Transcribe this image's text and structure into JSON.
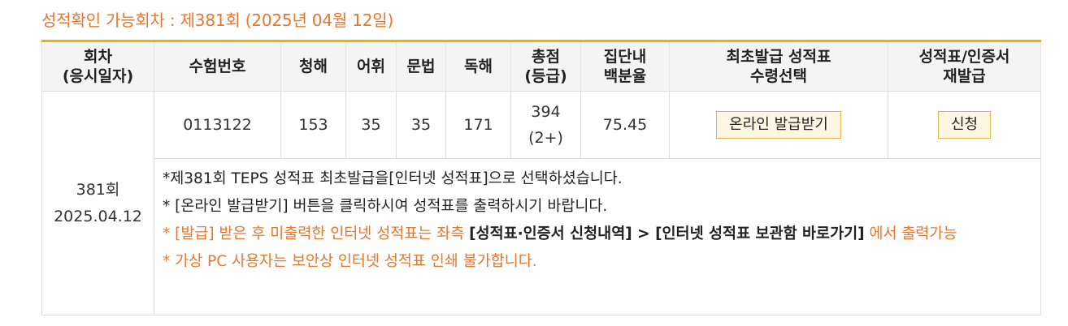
{
  "heading": "성적확인 가능회차 : 제381회 (2025년 04월 12일)",
  "table": {
    "headers": {
      "round_line1": "회차",
      "round_line2": "(응시일자)",
      "exam_no": "수험번호",
      "listening": "청해",
      "vocab": "어휘",
      "grammar": "문법",
      "reading": "독해",
      "total_line1": "총점",
      "total_line2": "(등급)",
      "pct_line1": "집단내",
      "pct_line2": "백분율",
      "issue_line1": "최초발급 성적표",
      "issue_line2": "수령선택",
      "reissue_line1": "성적표/인증서",
      "reissue_line2": "재발급"
    },
    "row": {
      "round": "381회",
      "date": "2025.04.12",
      "exam_no": "0113122",
      "listening": "153",
      "vocab": "35",
      "grammar": "35",
      "reading": "171",
      "total": "394",
      "grade": "(2+)",
      "percentile": "75.45",
      "issue_button": "온라인 발급받기",
      "reissue_button": "신청"
    }
  },
  "notes": {
    "n1": "*제381회 TEPS 성적표 최초발급을[인터넷 성적표]으로 선택하셨습니다.",
    "n2": "* [온라인 발급받기] 버튼을 클릭하시여 성적표를 출력하시기 바랍니다.",
    "n3_prefix": "* [발급] 받은 후 미출력한 인터넷 성적표는 좌측 ",
    "n3_link1": "[성적표·인증서 신청내역]",
    "n3_arrow": " > ",
    "n3_link2": "[인터넷 성적표 보관함 바로가기]",
    "n3_suffix": " 에서 출력가능",
    "n4": "* 가상 PC 사용자는 보안상 인터넷 성적표 인쇄 불가합니다."
  },
  "colors": {
    "accent_orange": "#e8772e",
    "header_top_border": "#f0b400",
    "button_bg": "#fdf6e3",
    "button_border": "#e2b64a"
  }
}
